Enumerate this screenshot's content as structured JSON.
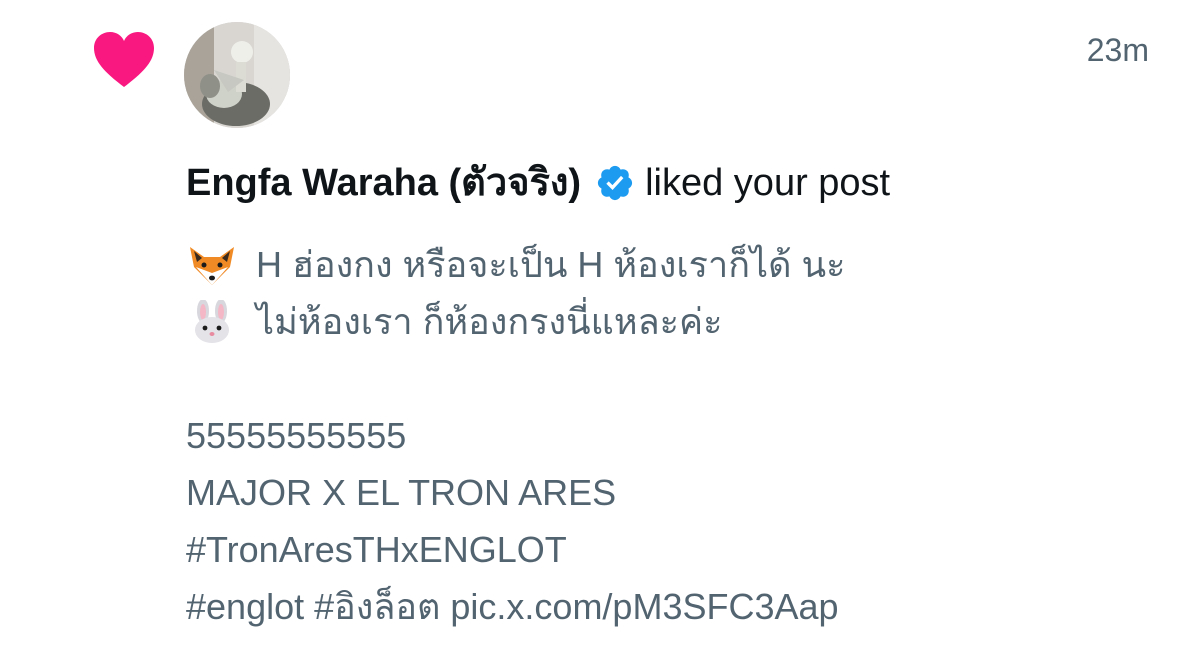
{
  "notification": {
    "type_icon": "heart-icon",
    "type_color": "#f91880",
    "timestamp": "23m",
    "user": {
      "name": "Engfa Waraha (ตัวจริง)",
      "verified_icon": "verified-badge-icon",
      "verified_color": "#1d9bf0"
    },
    "action": "liked your post",
    "post": {
      "line1_emoji": "fox-emoji-icon",
      "line1_text": "H ฮ่องกง หรือจะเป็น H ห้องเราก็ได้ นะ",
      "line2_emoji": "rabbit-emoji-icon",
      "line2_text": "ไม่ห้องเรา ก็ห้องกรงนี่แหละค่ะ",
      "line3": "55555555555",
      "line4": "MAJOR X EL TRON ARES",
      "line5": "#TronAresTHxENGLOT",
      "line6": "#englot #อิงล็อต pic.x.com/pM3SFC3Aap"
    }
  }
}
